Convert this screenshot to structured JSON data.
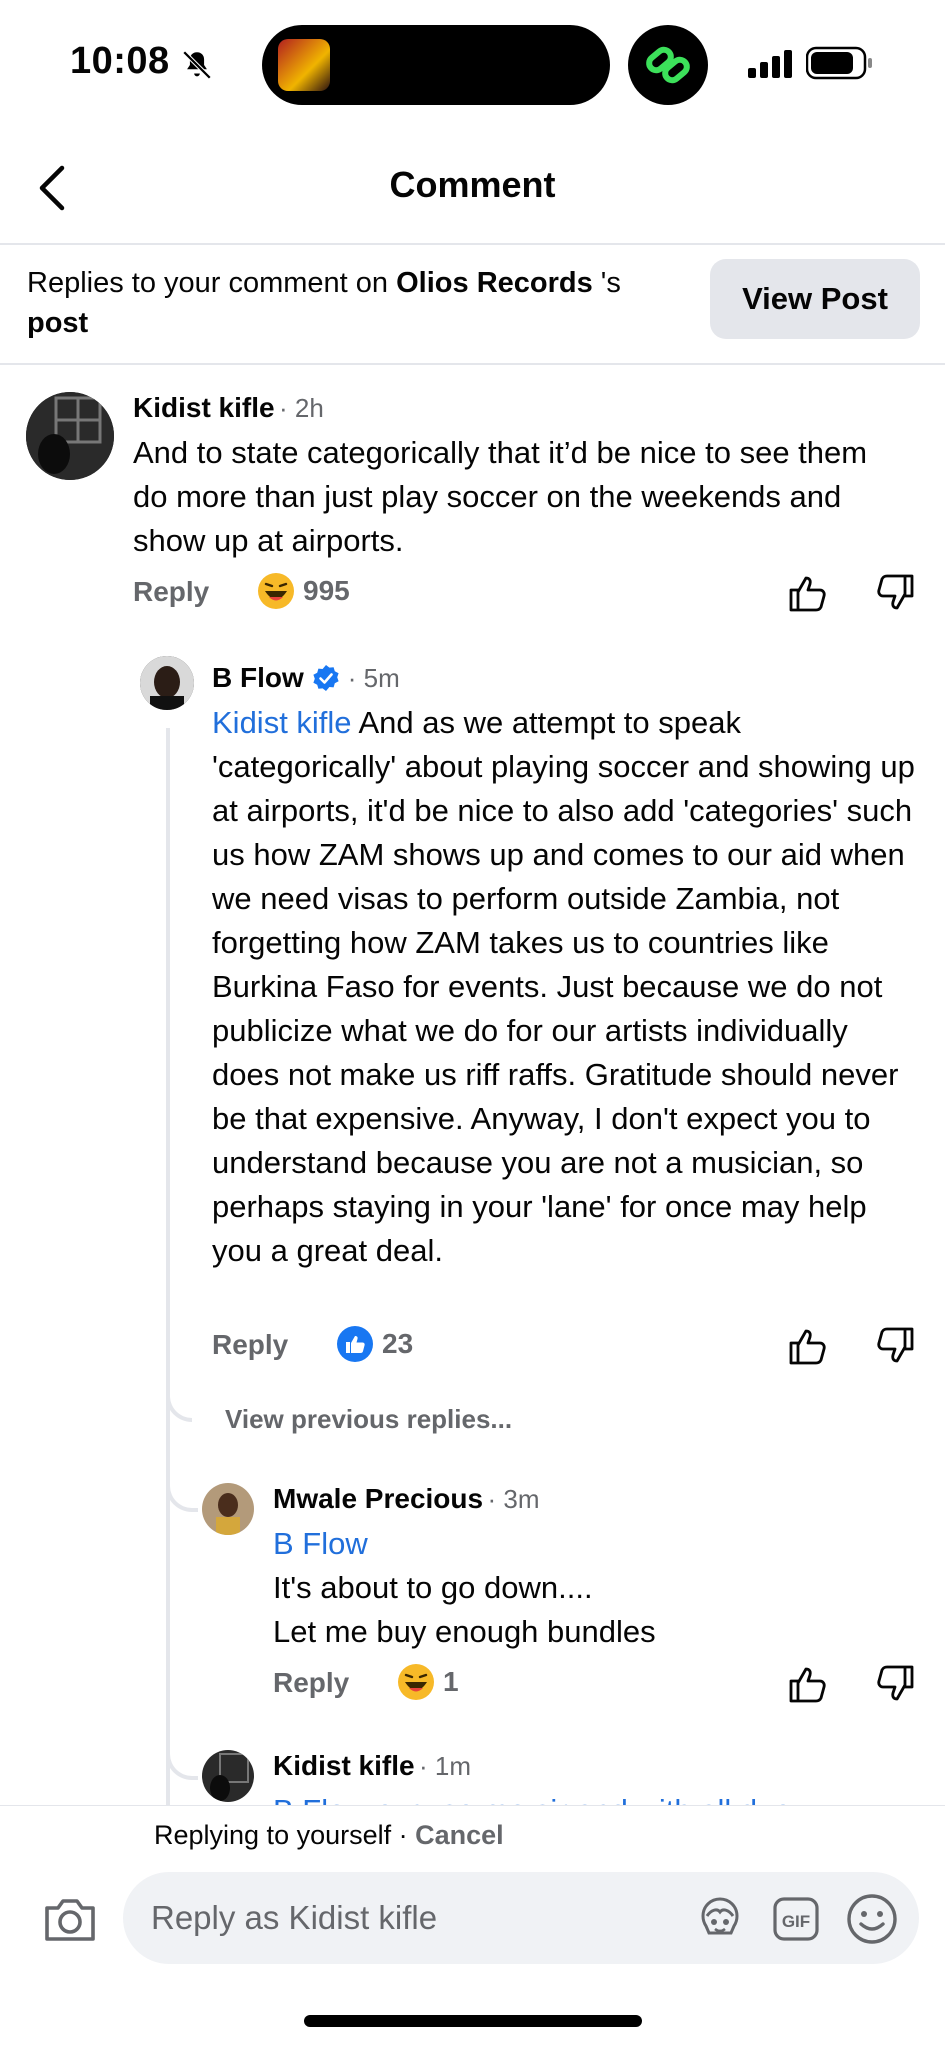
{
  "status_bar": {
    "time": "10:08"
  },
  "header": {
    "title": "Comment",
    "back_icon": "chevron-left-icon"
  },
  "context": {
    "prefix": "Replies to your comment on ",
    "page_name": "Olios Records",
    "suffix": " 's",
    "post_word": "post",
    "view_post_label": "View Post"
  },
  "comments": [
    {
      "author": "Kidist kifle",
      "time": "· 2h",
      "text": "And to state categorically that it’d be nice to see them do more than just play soccer on the weekends and show up at airports.",
      "reply_label": "Reply",
      "reaction_count": "995"
    },
    {
      "author": "B Flow",
      "time": "· 5m",
      "mention": "Kidist kifle",
      "text": " And as we attempt to speak 'categorically' about playing soccer and showing up at airports, it'd be nice to also add 'categories' such us how ZAM shows up and comes to our aid when we need visas to perform outside Zambia, not forgetting how ZAM takes us to countries like Burkina Faso for events. Just because we do not publicize what we do for our artists individually does not make us riff raffs. Gratitude should never be that expensive. Anyway, I don't expect you to understand because you are not a musician, so perhaps staying in your 'lane' for once may help you a great deal.",
      "reply_label": "Reply",
      "reaction_count": "23"
    },
    {
      "author": "Mwale Precious",
      "time": "· 3m",
      "mention": "B Flow",
      "line1": "It's about to go down....",
      "line2": "Let me buy enough bundles",
      "reply_label": "Reply",
      "reaction_count": "1"
    },
    {
      "author": "Kidist kifle",
      "time": "· 1m",
      "partial_text": "B Flow excuse me sir and with all due"
    }
  ],
  "view_previous_label": "View previous replies...",
  "composer": {
    "replying_to": "Replying to yourself",
    "separator": " · ",
    "cancel_label": "Cancel",
    "placeholder": "Reply as Kidist kifle"
  }
}
